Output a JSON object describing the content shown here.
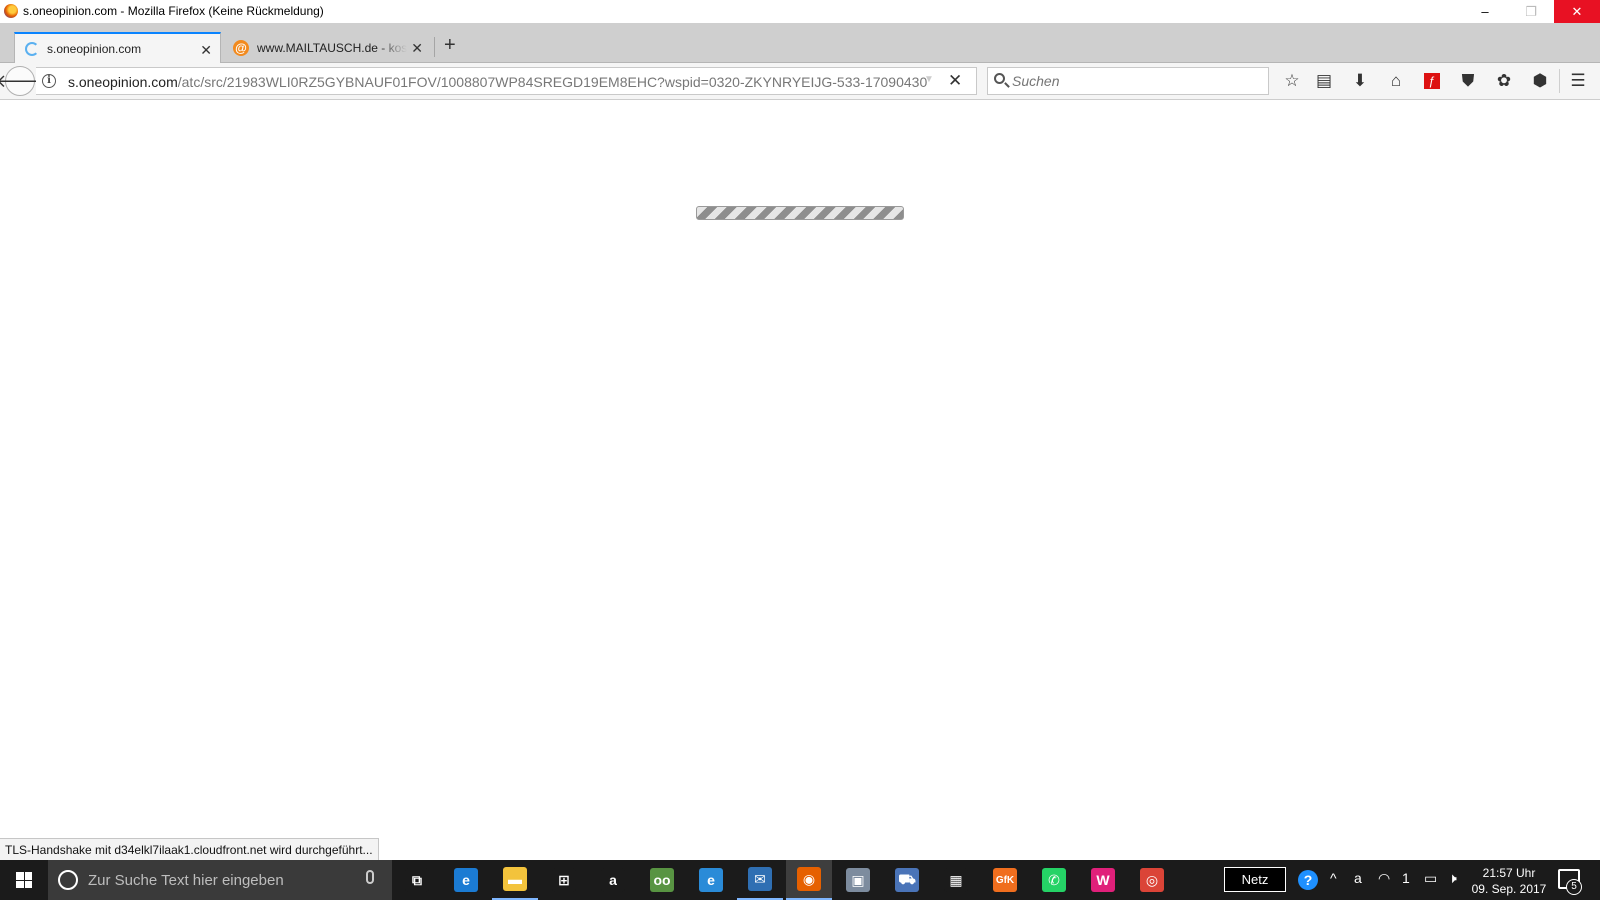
{
  "window": {
    "title": "s.oneopinion.com - Mozilla Firefox (Keine Rückmeldung)",
    "minimize": "–",
    "maximize": "❐",
    "close": "✕"
  },
  "tabs": [
    {
      "label": "s.oneopinion.com",
      "icon": "loading-spinner",
      "active": true
    },
    {
      "label": "www.MAILTAUSCH.de - kostenlos",
      "icon": "at-sign-icon",
      "active": false
    }
  ],
  "tab_close_glyph": "✕",
  "new_tab_glyph": "+",
  "navbar": {
    "back_glyph": "🡐",
    "url_host": "s.oneopinion.com",
    "url_path": "/atc/src/21983WLI0RZ5GYBNAUF01FOV/1008807WP84SREGD19EM8EHC?wspid=0320-ZKYNRYEIJG-533-17090430",
    "dropdown_glyph": "▼",
    "stop_glyph": "✕",
    "search_placeholder": "Suchen",
    "info_glyph": "i"
  },
  "toolbar": [
    {
      "name": "bookmark-star-icon",
      "glyph": "☆"
    },
    {
      "name": "reading-list-icon",
      "glyph": "▤"
    },
    {
      "name": "download-icon",
      "glyph": "⬇"
    },
    {
      "name": "home-icon",
      "glyph": "⌂"
    },
    {
      "name": "flash-icon",
      "glyph": "ƒ"
    },
    {
      "name": "pocket-icon",
      "glyph": "⛊"
    },
    {
      "name": "extension-icon",
      "glyph": "✿"
    },
    {
      "name": "shield-extension-icon",
      "glyph": "⬢"
    },
    {
      "name": "menu-icon",
      "glyph": "☰"
    }
  ],
  "content": {
    "loading_progress": "indeterminate"
  },
  "status_text": "TLS-Handshake mit d34elkl7ilaak1.cloudfront.net wird durchgeführt...",
  "taskbar": {
    "search_placeholder": "Zur Suche Text hier eingeben",
    "apps": [
      {
        "name": "task-view-icon",
        "glyph": "⧉",
        "color": "#1b1b1b",
        "state": ""
      },
      {
        "name": "edge-icon",
        "glyph": "e",
        "color": "#1b7bd3",
        "state": ""
      },
      {
        "name": "file-explorer-icon",
        "glyph": "▬",
        "color": "#f3c33c",
        "state": "running"
      },
      {
        "name": "store-icon",
        "glyph": "⊞",
        "color": "#1b1b1b",
        "state": ""
      },
      {
        "name": "amazon-icon",
        "glyph": "a",
        "color": "#1b1b1b",
        "state": ""
      },
      {
        "name": "tripadvisor-icon",
        "glyph": "oo",
        "color": "#589442",
        "state": ""
      },
      {
        "name": "internet-explorer-icon",
        "glyph": "e",
        "color": "#2a8bd8",
        "state": ""
      },
      {
        "name": "thunderbird-icon",
        "glyph": "✉",
        "color": "#2f6fb3",
        "state": "running"
      },
      {
        "name": "firefox-icon",
        "glyph": "◉",
        "color": "#e66000",
        "state": "active"
      },
      {
        "name": "remote-desktop-icon",
        "glyph": "▣",
        "color": "#7d8c9e",
        "state": ""
      },
      {
        "name": "network-app-icon",
        "glyph": "⛟",
        "color": "#4a74b8",
        "state": ""
      },
      {
        "name": "calculator-icon",
        "glyph": "▦",
        "color": "#1b1b1b",
        "state": ""
      },
      {
        "name": "gfk-icon",
        "glyph": "GfK",
        "color": "#f06e1e",
        "state": ""
      },
      {
        "name": "whatsapp-icon",
        "glyph": "✆",
        "color": "#25d366",
        "state": ""
      },
      {
        "name": "app-w-icon",
        "glyph": "W",
        "color": "#e0207a",
        "state": ""
      },
      {
        "name": "chrome-icon",
        "glyph": "◎",
        "color": "#db4437",
        "state": ""
      }
    ],
    "netz_label": "Netz",
    "tray": [
      {
        "name": "help-icon",
        "glyph": "?"
      },
      {
        "name": "tray-expand-icon",
        "glyph": "^"
      },
      {
        "name": "amazon-assistant-icon",
        "glyph": "a"
      },
      {
        "name": "wifi-icon",
        "glyph": "◠"
      },
      {
        "name": "sim-icon",
        "glyph": "1"
      },
      {
        "name": "battery-icon",
        "glyph": "▭"
      },
      {
        "name": "volume-muted-icon",
        "glyph": "🕨"
      }
    ],
    "clock_time": "21:57 Uhr",
    "clock_date": "09. Sep. 2017",
    "notification_count": "5"
  }
}
